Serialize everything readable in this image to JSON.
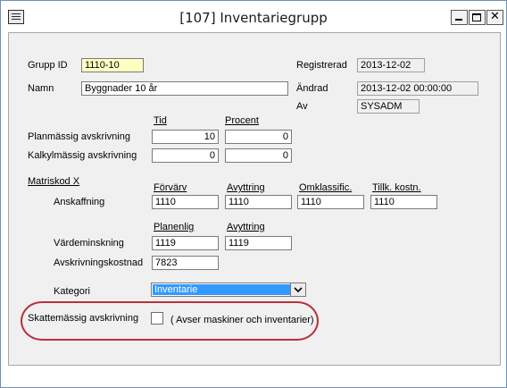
{
  "window": {
    "title": "[107]  Inventariegrupp"
  },
  "form": {
    "grupp_id_label": "Grupp ID",
    "grupp_id_value": "1110-10",
    "namn_label": "Namn",
    "namn_value": "Byggnader 10 år",
    "registrerad_label": "Registrerad",
    "registrerad_value": "2013-12-02",
    "andrad_label": "Ändrad",
    "andrad_value": "2013-12-02 00:00:00",
    "av_label": "Av",
    "av_value": "SYSADM",
    "tid_header": "Tid",
    "procent_header": "Procent",
    "planmassig_label": "Planmässig avskrivning",
    "planmassig_tid": "10",
    "planmassig_procent": "0",
    "kalkylmassig_label": "Kalkylmässig avskrivning",
    "kalkylmassig_tid": "0",
    "kalkylmassig_procent": "0",
    "matriskod_label": "Matriskod X",
    "forvarv_header": "Förvärv",
    "avyttring_header": "Avyttring",
    "omklassific_header": "Omklassific.",
    "tillk_header": "Tillk. kostn.",
    "anskaffning_label": "Anskaffning",
    "anskaffning_forvarv": "1110",
    "anskaffning_avyttring": "1110",
    "anskaffning_omklassific": "1110",
    "anskaffning_tillk": "1110",
    "planenlig_header": "Planenlig",
    "avyttring2_header": "Avyttring",
    "vardeminskning_label": "Värdeminskning",
    "vardeminskning_planenlig": "1119",
    "vardeminskning_avyttring": "1119",
    "avskrivningskostnad_label": "Avskrivningskostnad",
    "avskrivningskostnad_value": "7823",
    "kategori_label": "Kategori",
    "kategori_value": "Inventarie",
    "skattemassig_label": "Skattemässig avskrivning",
    "skattemassig_note": "( Avser maskiner och inventarier)",
    "skattemassig_checked": false
  },
  "colors": {
    "highlight": "#b5333e",
    "selection": "#3399ff",
    "required_field": "#ffffc4"
  }
}
